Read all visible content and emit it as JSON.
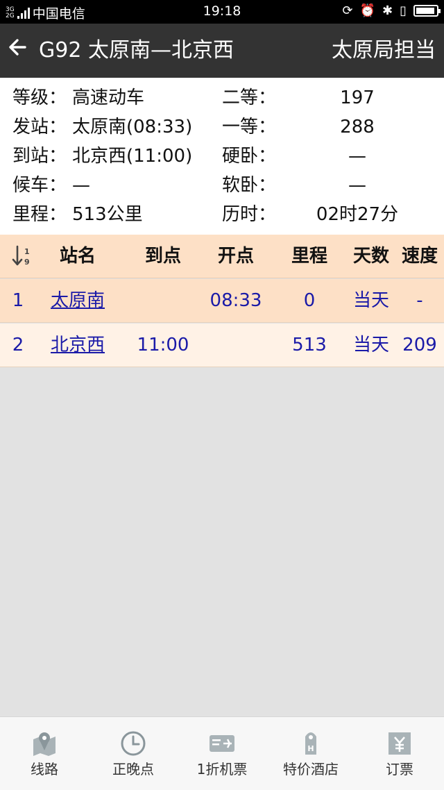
{
  "status_bar": {
    "network": [
      "3G",
      "2G"
    ],
    "carrier": "中国电信",
    "time": "19:18"
  },
  "header": {
    "title": "G92 太原南—北京西",
    "bureau": "太原局担当"
  },
  "train_info": {
    "rows": [
      {
        "label": "等级：",
        "value": "高速动车",
        "seat_label": "二等：",
        "seat_value": "197"
      },
      {
        "label": "发站：",
        "value": "太原南(08:33)",
        "seat_label": "一等：",
        "seat_value": "288"
      },
      {
        "label": "到站：",
        "value": "北京西(11:00)",
        "seat_label": "硬卧：",
        "seat_value": "—"
      },
      {
        "label": "候车：",
        "value": "—",
        "seat_label": "软卧：",
        "seat_value": "—"
      },
      {
        "label": "里程：",
        "value": "513公里",
        "seat_label": "历时：",
        "seat_value": "02时27分"
      }
    ]
  },
  "table": {
    "columns": [
      "站名",
      "到点",
      "开点",
      "里程",
      "天数",
      "速度"
    ],
    "rows": [
      {
        "no": "1",
        "station": "太原南",
        "arrive": "",
        "depart": "08:33",
        "mileage": "0",
        "day": "当天",
        "speed": "-"
      },
      {
        "no": "2",
        "station": "北京西",
        "arrive": "11:00",
        "depart": "",
        "mileage": "513",
        "day": "当天",
        "speed": "209"
      }
    ]
  },
  "tabs": [
    {
      "label": "线路",
      "icon": "map-icon"
    },
    {
      "label": "正晚点",
      "icon": "clock-icon"
    },
    {
      "label": "1折机票",
      "icon": "plane-ticket-icon"
    },
    {
      "label": "特价酒店",
      "icon": "hotel-tag-icon"
    },
    {
      "label": "订票",
      "icon": "yen-ticket-icon"
    }
  ],
  "colors": {
    "title_bar": "#333333",
    "table_header": "#fde0c6",
    "row_odd": "#fde0c6",
    "row_even": "#fff2e6",
    "link": "#1a1aa8",
    "background": "#e2e2e2"
  }
}
